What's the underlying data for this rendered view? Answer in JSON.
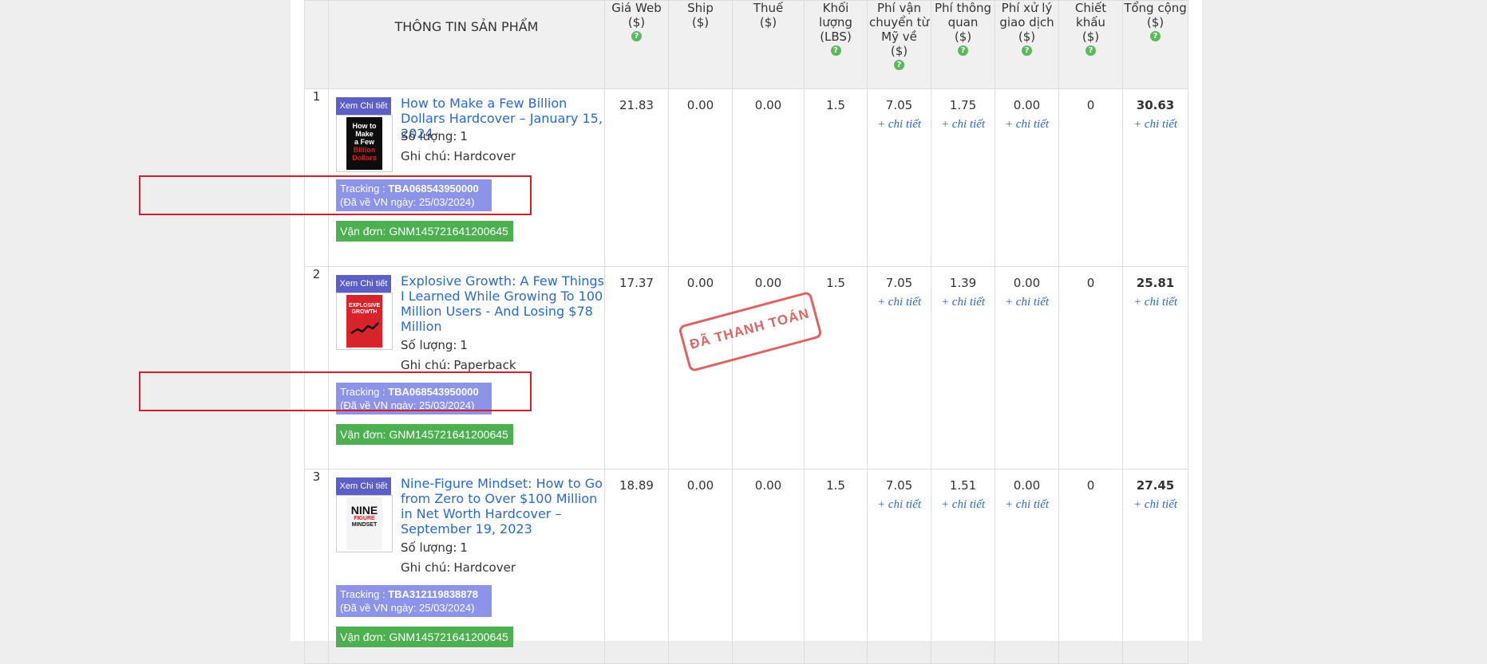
{
  "headers": {
    "info": "THÔNG TIN SẢN PHẨM",
    "web_price": [
      "Giá Web",
      "($)"
    ],
    "ship": [
      "Ship",
      "($)"
    ],
    "tax": [
      "Thuế",
      "($)"
    ],
    "weight": [
      "Khối",
      "lượng",
      "(LBS)"
    ],
    "us_shipping": [
      "Phí vận",
      "chuyển từ",
      "Mỹ về",
      "($)"
    ],
    "customs": [
      "Phí thông",
      "quan",
      "($)"
    ],
    "processing": [
      "Phí xử lý",
      "giao dịch",
      "($)"
    ],
    "discount": [
      "Chiết",
      "khấu",
      "($)"
    ],
    "total": [
      "Tổng cộng",
      "($)"
    ],
    "help_glyph": "?"
  },
  "labels": {
    "detail_button": "Xem Chi tiết",
    "quantity": "Số lượng:",
    "note": "Ghi chú:",
    "tracking": "Tracking :",
    "arrived_prefix": "(Đã về VN ngày:",
    "arrived_suffix": ")",
    "waybill": "Vận đơn:",
    "more": "+ chi tiết"
  },
  "rows": [
    {
      "index": "1",
      "title": "How to Make a Few Billion Dollars Hardcover – January 15, 2024",
      "cover_text": [
        "How to",
        "Make",
        "a Few",
        "Billion",
        "Dollars"
      ],
      "quantity": "1",
      "note": "Hardcover",
      "tracking": "TBA068543950000",
      "arrived": "25/03/2024",
      "waybill": "GNM145721641200645",
      "web_price": "21.83",
      "ship": "0.00",
      "tax": "0.00",
      "weight": "1.5",
      "us_shipping": "7.05",
      "customs": "1.75",
      "processing": "0.00",
      "discount": "0",
      "total": "30.63"
    },
    {
      "index": "2",
      "title": "Explosive Growth: A Few Things I Learned While Growing To 100 Million Users - And Losing $78 Million",
      "cover_text": [
        "EXPLOSIVE",
        "GROWTH"
      ],
      "quantity": "1",
      "note": "Paperback",
      "tracking": "TBA068543950000",
      "arrived": "25/03/2024",
      "waybill": "GNM145721641200645",
      "web_price": "17.37",
      "ship": "0.00",
      "tax": "0.00",
      "weight": "1.5",
      "us_shipping": "7.05",
      "customs": "1.39",
      "processing": "0.00",
      "discount": "0",
      "total": "25.81"
    },
    {
      "index": "3",
      "title": "Nine-Figure Mindset: How to Go from Zero to Over $100 Million in Net Worth Hardcover – September 19, 2023",
      "cover_text": [
        "NINE",
        "FIGURE",
        "MINDSET"
      ],
      "quantity": "1",
      "note": "Hardcover",
      "tracking": "TBA312119838878",
      "arrived": "25/03/2024",
      "waybill": "GNM145721641200645",
      "web_price": "18.89",
      "ship": "0.00",
      "tax": "0.00",
      "weight": "1.5",
      "us_shipping": "7.05",
      "customs": "1.51",
      "processing": "0.00",
      "discount": "0",
      "total": "27.45"
    }
  ],
  "stamp": "ĐÃ THANH TOÁN",
  "colors": {
    "link": "#2a6ac9",
    "detail_button": "#5b5fc7",
    "tracking_badge": "#8c93e8",
    "waybill_badge": "#4cb050",
    "help_icon": "#5cb85c",
    "highlight_box": "#d0202a",
    "stamp": "#d94a4a"
  }
}
